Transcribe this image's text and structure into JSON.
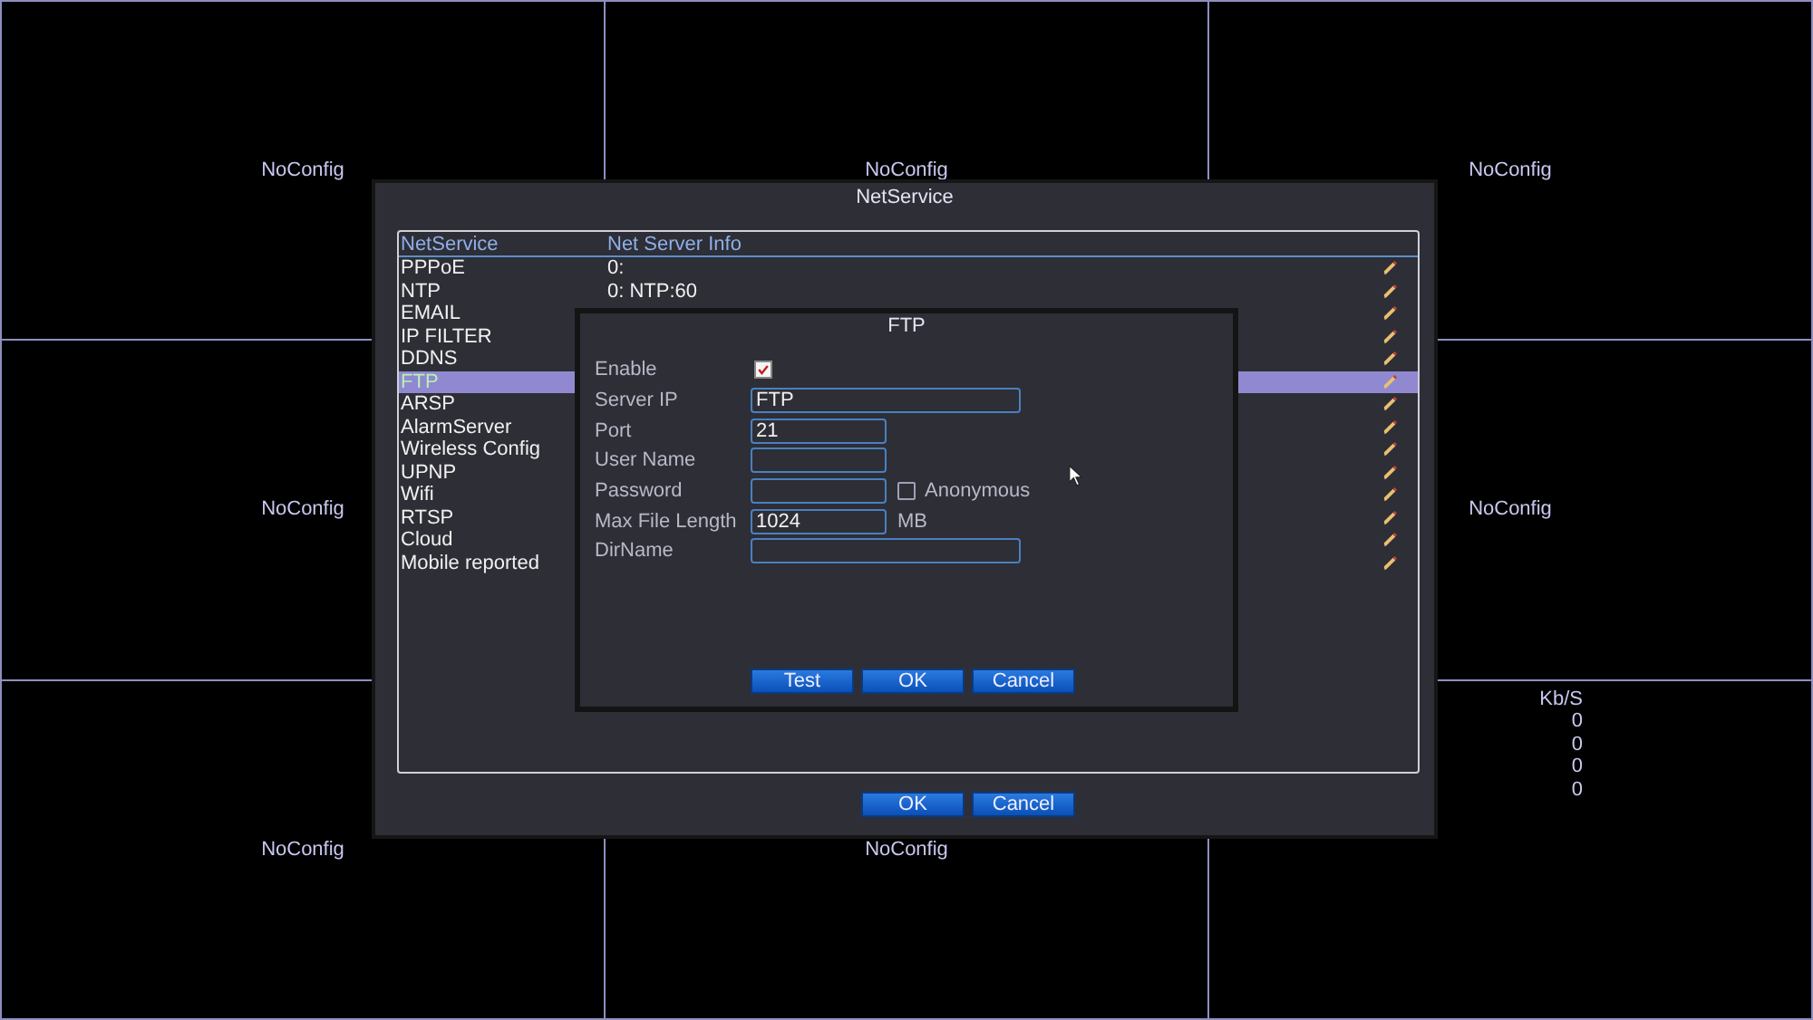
{
  "tiles": [
    {
      "label": "NoConfig"
    },
    {
      "label": "NoConfig"
    },
    {
      "label": "NoConfig"
    },
    {
      "label": "NoConfig"
    },
    {
      "label": "NoConfig"
    },
    {
      "label": "NoConfig"
    },
    {
      "label": "NoConfig"
    },
    {
      "stats": {
        "header": "Kb/S",
        "values": [
          "0",
          "0",
          "0",
          "0"
        ]
      }
    }
  ],
  "dialog": {
    "title": "NetService",
    "columns": [
      "NetService",
      "Net Server Info"
    ],
    "rows": [
      {
        "name": "PPPoE",
        "info": "0:",
        "selected": false
      },
      {
        "name": "NTP",
        "info": "0: NTP:60",
        "selected": false
      },
      {
        "name": "EMAIL",
        "selected": false
      },
      {
        "name": "IP FILTER",
        "selected": false
      },
      {
        "name": "DDNS",
        "selected": false
      },
      {
        "name": "FTP",
        "selected": true
      },
      {
        "name": "ARSP",
        "selected": false
      },
      {
        "name": "AlarmServer",
        "selected": false
      },
      {
        "name": "Wireless Config",
        "selected": false
      },
      {
        "name": "UPNP",
        "selected": false
      },
      {
        "name": "Wifi",
        "selected": false
      },
      {
        "name": "RTSP",
        "selected": false
      },
      {
        "name": "Cloud",
        "selected": false
      },
      {
        "name": "Mobile reported",
        "selected": false
      }
    ],
    "buttons": [
      "OK",
      "Cancel"
    ]
  },
  "ftp": {
    "title": "FTP",
    "enable": {
      "label": "Enable",
      "checked": true
    },
    "fields": [
      {
        "label": "Server IP",
        "value": "FTP",
        "kind": "wide"
      },
      {
        "label": "Port",
        "value": "21",
        "kind": "short"
      },
      {
        "label": "User Name",
        "kind": "short"
      },
      {
        "label": "Password",
        "kind": "short",
        "option": {
          "label": "Anonymous",
          "checked": false
        }
      },
      {
        "label": "Max File Length",
        "value": "1024",
        "kind": "short",
        "unit": "MB"
      },
      {
        "label": "DirName",
        "kind": "wide"
      }
    ],
    "buttons": [
      "Test",
      "OK",
      "Cancel"
    ]
  }
}
